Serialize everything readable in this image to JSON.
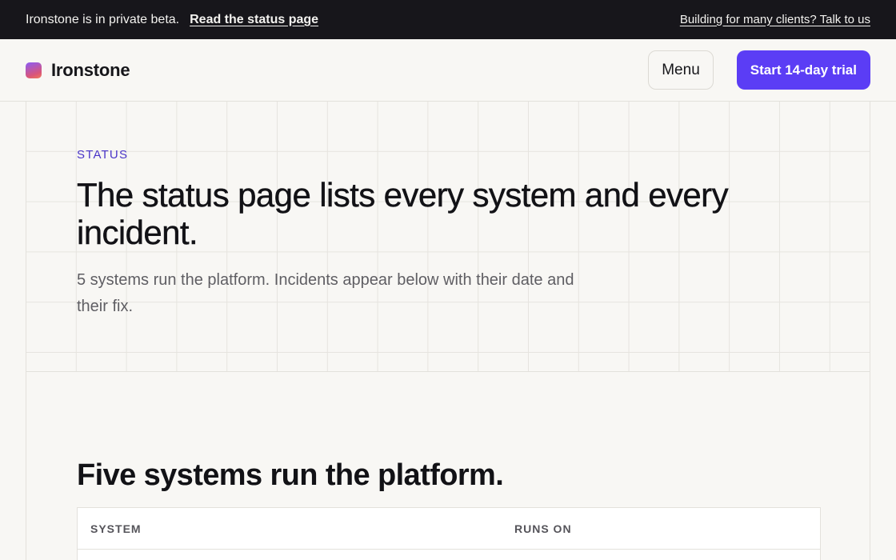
{
  "banner": {
    "message": "Ironstone is in private beta.",
    "status_link": "Read the status page",
    "clients_link": "Building for many clients? Talk to us"
  },
  "nav": {
    "brand": "Ironstone",
    "menu_label": "Menu",
    "trial_label": "Start 14-day trial"
  },
  "hero": {
    "eyebrow": "STATUS",
    "title": "The status page lists every system and every incident.",
    "subtitle": "5 systems run the platform. Incidents appear below with their date and their fix."
  },
  "systems": {
    "title": "Five systems run the platform.",
    "columns": [
      "SYSTEM",
      "RUNS ON"
    ]
  },
  "colors": {
    "accent": "#5b3df5",
    "eyebrow": "#4a35c8",
    "banner_bg": "#17161b",
    "page_bg": "#f8f7f4"
  },
  "icons": {
    "logo": "gradient-square-logo"
  }
}
